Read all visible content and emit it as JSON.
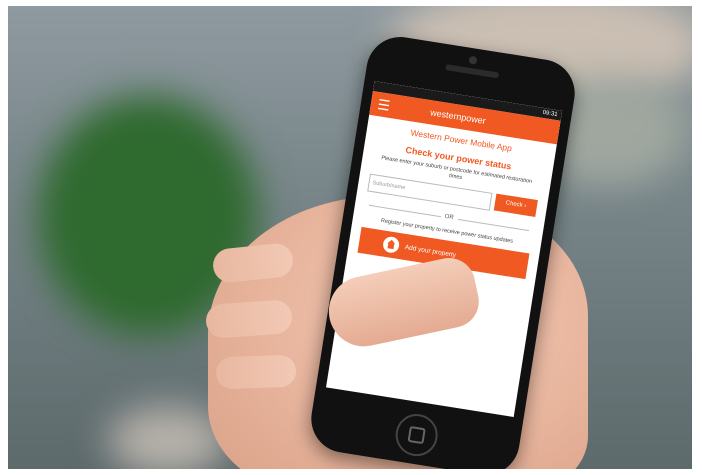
{
  "app": {
    "status_time": "09:31",
    "brand": "westernpower",
    "title": "Western Power Mobile App",
    "subtitle": "Check your power status",
    "instruction": "Please enter your suburb or postcode for estimated restoration times",
    "suburb_placeholder": "Suburb/name",
    "check_label": "Check",
    "or_label": "OR",
    "register_text": "Register your property to receive power status updates",
    "add_label": "Add your property"
  },
  "colors": {
    "accent": "#f05a22"
  }
}
